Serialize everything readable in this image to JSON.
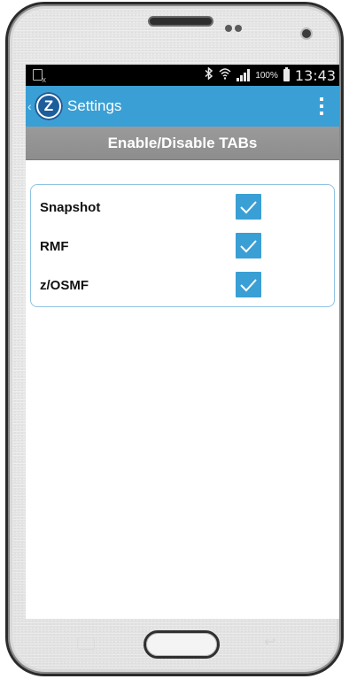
{
  "status_bar": {
    "battery_percent": "100%",
    "clock": "13:43",
    "icons": [
      "sdcard-icon",
      "bluetooth-icon",
      "wifi-icon",
      "signal-icon",
      "battery-icon"
    ]
  },
  "action_bar": {
    "logo_letter": "Z",
    "title": "Settings",
    "color": "#3a9fd4"
  },
  "section": {
    "title": "Enable/Disable TABs"
  },
  "tabs": [
    {
      "label": "Snapshot",
      "checked": true
    },
    {
      "label": "RMF",
      "checked": true
    },
    {
      "label": "z/OSMF",
      "checked": true
    }
  ]
}
